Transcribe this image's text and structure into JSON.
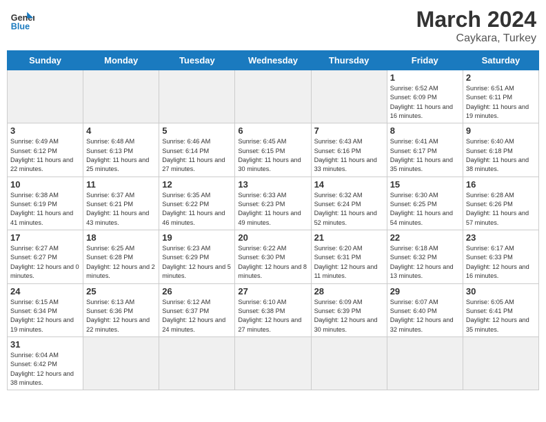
{
  "header": {
    "logo_general": "General",
    "logo_blue": "Blue",
    "month_year": "March 2024",
    "location": "Caykara, Turkey"
  },
  "weekdays": [
    "Sunday",
    "Monday",
    "Tuesday",
    "Wednesday",
    "Thursday",
    "Friday",
    "Saturday"
  ],
  "weeks": [
    [
      {
        "day": "",
        "empty": true
      },
      {
        "day": "",
        "empty": true
      },
      {
        "day": "",
        "empty": true
      },
      {
        "day": "",
        "empty": true
      },
      {
        "day": "",
        "empty": true
      },
      {
        "day": "1",
        "sunrise": "6:52 AM",
        "sunset": "6:09 PM",
        "daylight": "11 hours and 16 minutes."
      },
      {
        "day": "2",
        "sunrise": "6:51 AM",
        "sunset": "6:11 PM",
        "daylight": "11 hours and 19 minutes."
      }
    ],
    [
      {
        "day": "3",
        "sunrise": "6:49 AM",
        "sunset": "6:12 PM",
        "daylight": "11 hours and 22 minutes."
      },
      {
        "day": "4",
        "sunrise": "6:48 AM",
        "sunset": "6:13 PM",
        "daylight": "11 hours and 25 minutes."
      },
      {
        "day": "5",
        "sunrise": "6:46 AM",
        "sunset": "6:14 PM",
        "daylight": "11 hours and 27 minutes."
      },
      {
        "day": "6",
        "sunrise": "6:45 AM",
        "sunset": "6:15 PM",
        "daylight": "11 hours and 30 minutes."
      },
      {
        "day": "7",
        "sunrise": "6:43 AM",
        "sunset": "6:16 PM",
        "daylight": "11 hours and 33 minutes."
      },
      {
        "day": "8",
        "sunrise": "6:41 AM",
        "sunset": "6:17 PM",
        "daylight": "11 hours and 35 minutes."
      },
      {
        "day": "9",
        "sunrise": "6:40 AM",
        "sunset": "6:18 PM",
        "daylight": "11 hours and 38 minutes."
      }
    ],
    [
      {
        "day": "10",
        "sunrise": "6:38 AM",
        "sunset": "6:19 PM",
        "daylight": "11 hours and 41 minutes."
      },
      {
        "day": "11",
        "sunrise": "6:37 AM",
        "sunset": "6:21 PM",
        "daylight": "11 hours and 43 minutes."
      },
      {
        "day": "12",
        "sunrise": "6:35 AM",
        "sunset": "6:22 PM",
        "daylight": "11 hours and 46 minutes."
      },
      {
        "day": "13",
        "sunrise": "6:33 AM",
        "sunset": "6:23 PM",
        "daylight": "11 hours and 49 minutes."
      },
      {
        "day": "14",
        "sunrise": "6:32 AM",
        "sunset": "6:24 PM",
        "daylight": "11 hours and 52 minutes."
      },
      {
        "day": "15",
        "sunrise": "6:30 AM",
        "sunset": "6:25 PM",
        "daylight": "11 hours and 54 minutes."
      },
      {
        "day": "16",
        "sunrise": "6:28 AM",
        "sunset": "6:26 PM",
        "daylight": "11 hours and 57 minutes."
      }
    ],
    [
      {
        "day": "17",
        "sunrise": "6:27 AM",
        "sunset": "6:27 PM",
        "daylight": "12 hours and 0 minutes."
      },
      {
        "day": "18",
        "sunrise": "6:25 AM",
        "sunset": "6:28 PM",
        "daylight": "12 hours and 2 minutes."
      },
      {
        "day": "19",
        "sunrise": "6:23 AM",
        "sunset": "6:29 PM",
        "daylight": "12 hours and 5 minutes."
      },
      {
        "day": "20",
        "sunrise": "6:22 AM",
        "sunset": "6:30 PM",
        "daylight": "12 hours and 8 minutes."
      },
      {
        "day": "21",
        "sunrise": "6:20 AM",
        "sunset": "6:31 PM",
        "daylight": "12 hours and 11 minutes."
      },
      {
        "day": "22",
        "sunrise": "6:18 AM",
        "sunset": "6:32 PM",
        "daylight": "12 hours and 13 minutes."
      },
      {
        "day": "23",
        "sunrise": "6:17 AM",
        "sunset": "6:33 PM",
        "daylight": "12 hours and 16 minutes."
      }
    ],
    [
      {
        "day": "24",
        "sunrise": "6:15 AM",
        "sunset": "6:34 PM",
        "daylight": "12 hours and 19 minutes."
      },
      {
        "day": "25",
        "sunrise": "6:13 AM",
        "sunset": "6:36 PM",
        "daylight": "12 hours and 22 minutes."
      },
      {
        "day": "26",
        "sunrise": "6:12 AM",
        "sunset": "6:37 PM",
        "daylight": "12 hours and 24 minutes."
      },
      {
        "day": "27",
        "sunrise": "6:10 AM",
        "sunset": "6:38 PM",
        "daylight": "12 hours and 27 minutes."
      },
      {
        "day": "28",
        "sunrise": "6:09 AM",
        "sunset": "6:39 PM",
        "daylight": "12 hours and 30 minutes."
      },
      {
        "day": "29",
        "sunrise": "6:07 AM",
        "sunset": "6:40 PM",
        "daylight": "12 hours and 32 minutes."
      },
      {
        "day": "30",
        "sunrise": "6:05 AM",
        "sunset": "6:41 PM",
        "daylight": "12 hours and 35 minutes."
      }
    ],
    [
      {
        "day": "31",
        "sunrise": "6:04 AM",
        "sunset": "6:42 PM",
        "daylight": "12 hours and 38 minutes."
      },
      {
        "day": "",
        "empty": true
      },
      {
        "day": "",
        "empty": true
      },
      {
        "day": "",
        "empty": true
      },
      {
        "day": "",
        "empty": true
      },
      {
        "day": "",
        "empty": true
      },
      {
        "day": "",
        "empty": true
      }
    ]
  ]
}
